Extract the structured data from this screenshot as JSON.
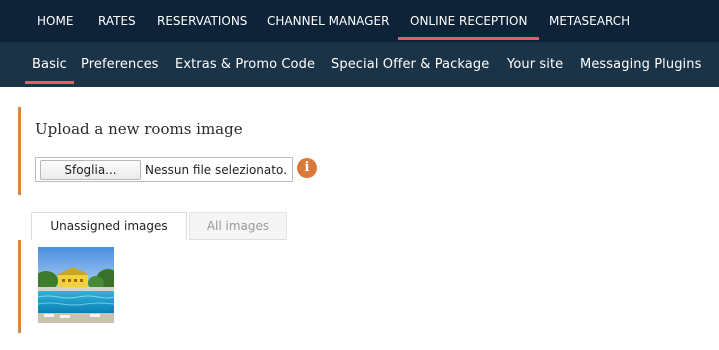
{
  "topnav": {
    "items": [
      {
        "label": "HOME"
      },
      {
        "label": "RATES"
      },
      {
        "label": "RESERVATIONS"
      },
      {
        "label": "CHANNEL MANAGER"
      },
      {
        "label": "ONLINE RECEPTION"
      },
      {
        "label": "METASEARCH"
      }
    ],
    "active_index": 4
  },
  "subnav": {
    "items": [
      {
        "label": "Basic"
      },
      {
        "label": "Preferences"
      },
      {
        "label": "Extras & Promo Code"
      },
      {
        "label": "Special Offer & Package"
      },
      {
        "label": "Your site"
      },
      {
        "label": "Messaging Plugins"
      }
    ],
    "active_index": 0
  },
  "upload": {
    "title": "Upload a new rooms image",
    "browse_label": "Sfoglia...",
    "file_status": "Nessun file selezionato.",
    "info_icon": "info-icon"
  },
  "tabs": [
    {
      "label": "Unassigned images",
      "active": true
    },
    {
      "label": "All images",
      "active": false
    }
  ],
  "images": [
    {
      "subject": "hotel-pool-photo"
    }
  ],
  "colors": {
    "topnav_bg": "#0e2338",
    "subnav_bg": "#1b3346",
    "active_underline": "#e65c6a",
    "accent_bar": "#d48844",
    "info_icon": "#d9793b"
  }
}
